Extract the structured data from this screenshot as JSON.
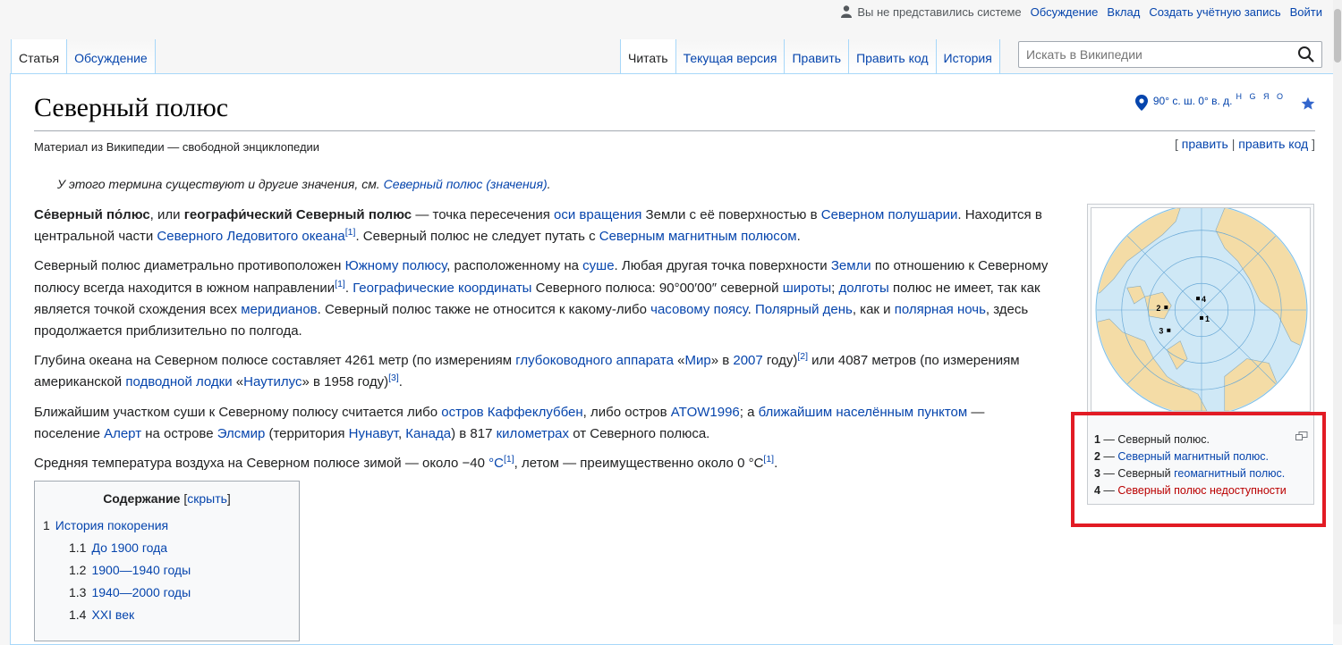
{
  "personal": {
    "not_logged": "Вы не представились системе",
    "talk": "Обсуждение",
    "contributions": "Вклад",
    "create_account": "Создать учётную запись",
    "login": "Войти"
  },
  "tabs_left": [
    "Статья",
    "Обсуждение"
  ],
  "tabs_right": [
    "Читать",
    "Текущая версия",
    "Править",
    "Править код",
    "История"
  ],
  "search": {
    "placeholder": "Искать в Википедии"
  },
  "page": {
    "title": "Северный полюс",
    "subtitle": "Материал из Википедии — свободной энциклопедии",
    "coords": "90° с. ш. 0° в. д.",
    "coords_sup": "H G Я O",
    "edit": "править",
    "edit_code": "править код"
  },
  "hatnote": {
    "text": "У этого термина существуют и другие значения, см. ",
    "link": "Северный полюс (значения)",
    "end": "."
  },
  "caption": {
    "items": [
      {
        "num": "1",
        "sep": " — ",
        "text": "Северный полюс."
      },
      {
        "num": "2",
        "sep": " — ",
        "text": "Северный магнитный полюс."
      },
      {
        "num": "3",
        "sep": " — Северный ",
        "text": "геомагнитный полюс."
      },
      {
        "num": "4",
        "sep": " — ",
        "text": "Северный полюс недоступности"
      }
    ]
  },
  "toc": {
    "title": "Содержание",
    "hide": "скрыть",
    "items": [
      {
        "num": "1",
        "text": "История покорения"
      },
      {
        "num": "1.1",
        "text": "До 1900 года"
      },
      {
        "num": "1.2",
        "text": "1900—1940 годы"
      },
      {
        "num": "1.3",
        "text": "1940—2000 годы"
      },
      {
        "num": "1.4",
        "text": "XXI век"
      }
    ]
  },
  "colors": {
    "link": "#0645ad",
    "redlink": "#ba0000",
    "highlight": "#e21b24",
    "ocean": "#cfe8f6",
    "land": "#f4dca6"
  }
}
